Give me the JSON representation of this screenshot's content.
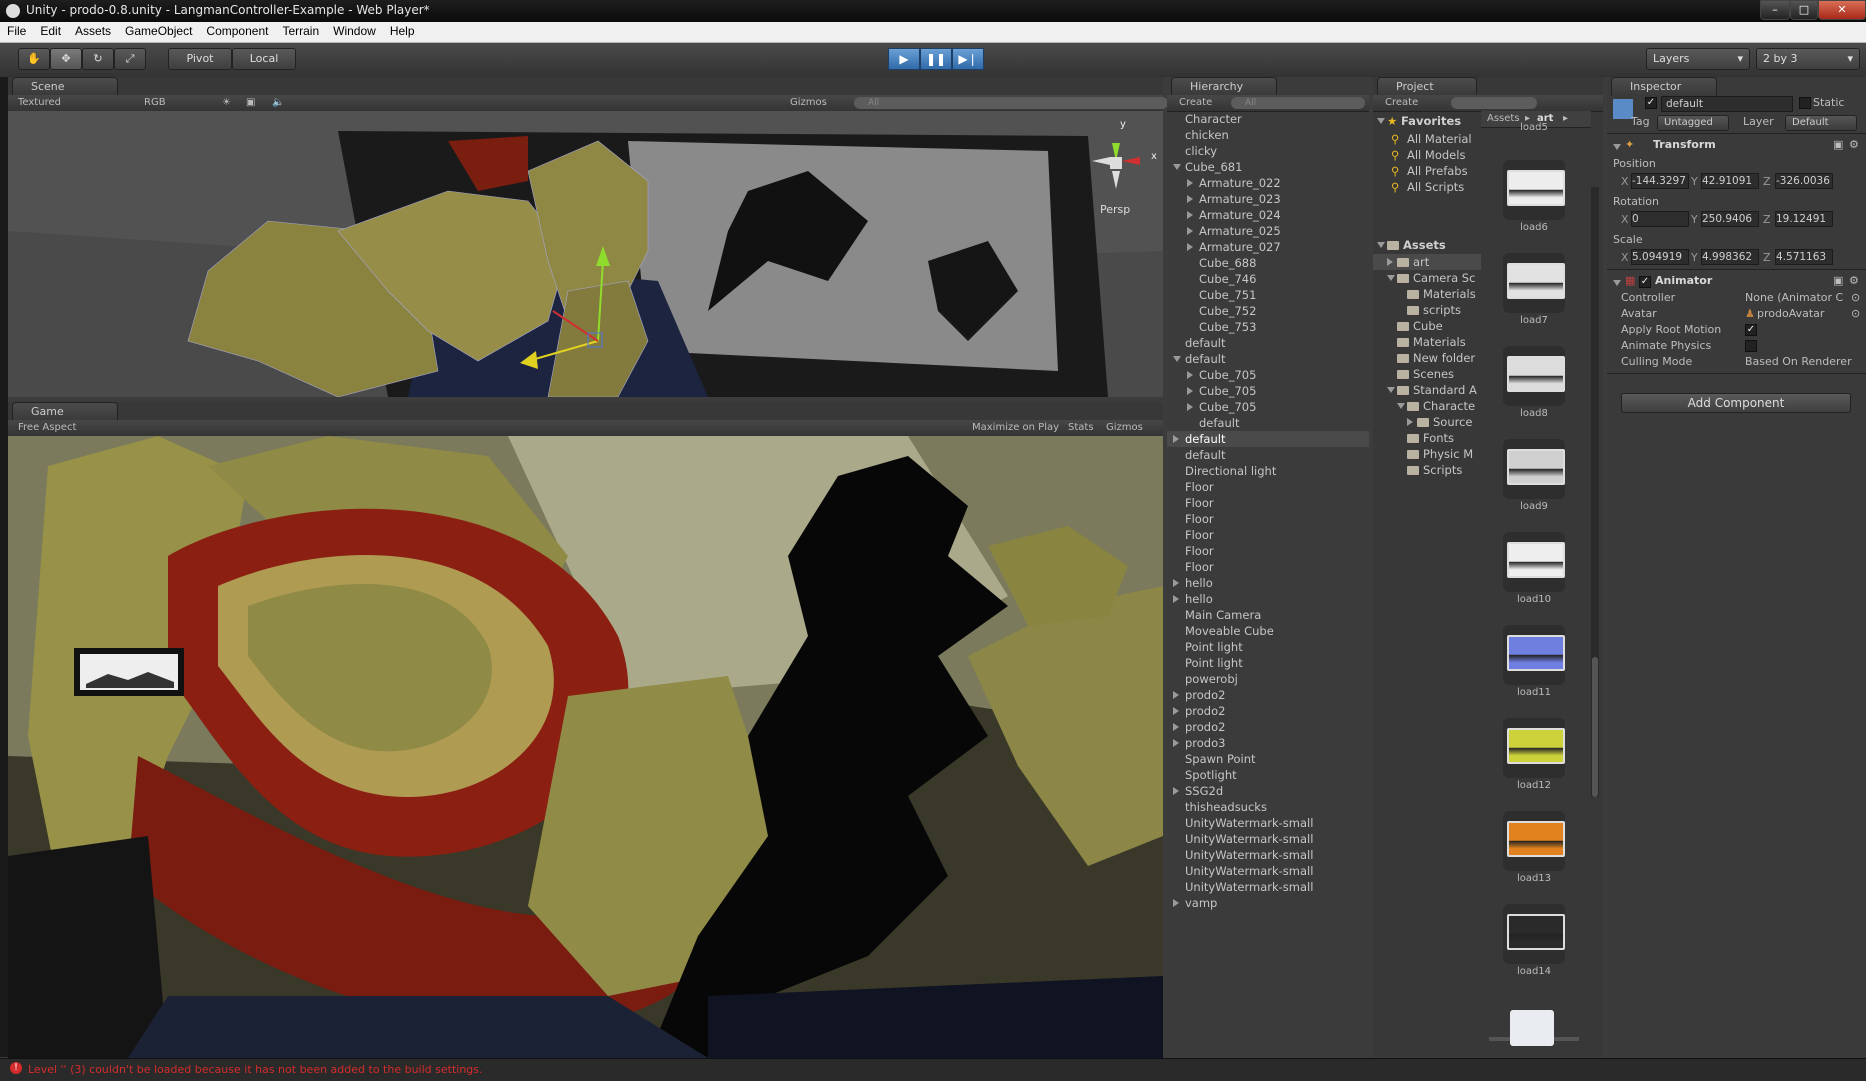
{
  "window": {
    "title": "Unity - prodo-0.8.unity - LangmanController-Example - Web Player*",
    "min": "–",
    "max": "□",
    "close": "✕"
  },
  "menu": [
    "File",
    "Edit",
    "Assets",
    "GameObject",
    "Component",
    "Terrain",
    "Window",
    "Help"
  ],
  "toolbar": {
    "pivot": "Pivot",
    "local": "Local",
    "layers": "Layers",
    "layout": "2 by 3"
  },
  "scene": {
    "tab": "Scene",
    "render_mode": "Textured",
    "color_mode": "RGB",
    "gizmos": "Gizmos",
    "search_placeholder": "All",
    "persp": "Persp",
    "axis_y": "y",
    "axis_x": "x"
  },
  "game": {
    "tab": "Game",
    "aspect": "Free Aspect",
    "maximize": "Maximize on Play",
    "stats": "Stats",
    "gizmos": "Gizmos"
  },
  "hierarchy": {
    "tab": "Hierarchy",
    "create": "Create",
    "search_placeholder": "All",
    "items": [
      {
        "label": "Character",
        "indent": 0,
        "arrow": "none"
      },
      {
        "label": "chicken",
        "indent": 0,
        "arrow": "none"
      },
      {
        "label": "clicky",
        "indent": 0,
        "arrow": "none"
      },
      {
        "label": "Cube_681",
        "indent": 0,
        "arrow": "down"
      },
      {
        "label": "Armature_022",
        "indent": 1,
        "arrow": "right"
      },
      {
        "label": "Armature_023",
        "indent": 1,
        "arrow": "right"
      },
      {
        "label": "Armature_024",
        "indent": 1,
        "arrow": "right"
      },
      {
        "label": "Armature_025",
        "indent": 1,
        "arrow": "right"
      },
      {
        "label": "Armature_027",
        "indent": 1,
        "arrow": "right"
      },
      {
        "label": "Cube_688",
        "indent": 1,
        "arrow": "none"
      },
      {
        "label": "Cube_746",
        "indent": 1,
        "arrow": "none"
      },
      {
        "label": "Cube_751",
        "indent": 1,
        "arrow": "none"
      },
      {
        "label": "Cube_752",
        "indent": 1,
        "arrow": "none"
      },
      {
        "label": "Cube_753",
        "indent": 1,
        "arrow": "none"
      },
      {
        "label": "default",
        "indent": 0,
        "arrow": "none"
      },
      {
        "label": "default",
        "indent": 0,
        "arrow": "down"
      },
      {
        "label": "Cube_705",
        "indent": 1,
        "arrow": "right"
      },
      {
        "label": "Cube_705",
        "indent": 1,
        "arrow": "right"
      },
      {
        "label": "Cube_705",
        "indent": 1,
        "arrow": "right"
      },
      {
        "label": "default",
        "indent": 1,
        "arrow": "none"
      },
      {
        "label": "default",
        "indent": 0,
        "arrow": "right",
        "selected": true
      },
      {
        "label": "default",
        "indent": 0,
        "arrow": "none"
      },
      {
        "label": "Directional light",
        "indent": 0,
        "arrow": "none"
      },
      {
        "label": "Floor",
        "indent": 0,
        "arrow": "none"
      },
      {
        "label": "Floor",
        "indent": 0,
        "arrow": "none"
      },
      {
        "label": "Floor",
        "indent": 0,
        "arrow": "none"
      },
      {
        "label": "Floor",
        "indent": 0,
        "arrow": "none"
      },
      {
        "label": "Floor",
        "indent": 0,
        "arrow": "none"
      },
      {
        "label": "Floor",
        "indent": 0,
        "arrow": "none"
      },
      {
        "label": "hello",
        "indent": 0,
        "arrow": "right"
      },
      {
        "label": "hello",
        "indent": 0,
        "arrow": "right"
      },
      {
        "label": "Main Camera",
        "indent": 0,
        "arrow": "none"
      },
      {
        "label": "Moveable Cube",
        "indent": 0,
        "arrow": "none"
      },
      {
        "label": "Point light",
        "indent": 0,
        "arrow": "none"
      },
      {
        "label": "Point light",
        "indent": 0,
        "arrow": "none"
      },
      {
        "label": "powerobj",
        "indent": 0,
        "arrow": "none"
      },
      {
        "label": "prodo2",
        "indent": 0,
        "arrow": "right"
      },
      {
        "label": "prodo2",
        "indent": 0,
        "arrow": "right"
      },
      {
        "label": "prodo2",
        "indent": 0,
        "arrow": "right"
      },
      {
        "label": "prodo3",
        "indent": 0,
        "arrow": "right"
      },
      {
        "label": "Spawn Point",
        "indent": 0,
        "arrow": "none"
      },
      {
        "label": "Spotlight",
        "indent": 0,
        "arrow": "none"
      },
      {
        "label": "SSG2d",
        "indent": 0,
        "arrow": "right"
      },
      {
        "label": "thisheadsucks",
        "indent": 0,
        "arrow": "none"
      },
      {
        "label": "UnityWatermark-small",
        "indent": 0,
        "arrow": "none"
      },
      {
        "label": "UnityWatermark-small",
        "indent": 0,
        "arrow": "none"
      },
      {
        "label": "UnityWatermark-small",
        "indent": 0,
        "arrow": "none"
      },
      {
        "label": "UnityWatermark-small",
        "indent": 0,
        "arrow": "none"
      },
      {
        "label": "UnityWatermark-small",
        "indent": 0,
        "arrow": "none"
      },
      {
        "label": "vamp",
        "indent": 0,
        "arrow": "right"
      }
    ]
  },
  "project": {
    "tab": "Project",
    "create": "Create",
    "favorites_label": "Favorites",
    "favorites": [
      "All Material",
      "All Models",
      "All Prefabs",
      "All Scripts"
    ],
    "assets_label": "Assets",
    "tree": [
      {
        "label": "art",
        "indent": 1,
        "arrow": "right",
        "selected": true
      },
      {
        "label": "Camera Sc",
        "indent": 1,
        "arrow": "down"
      },
      {
        "label": "Materials",
        "indent": 2,
        "arrow": "none"
      },
      {
        "label": "scripts",
        "indent": 2,
        "arrow": "none"
      },
      {
        "label": "Cube",
        "indent": 1,
        "arrow": "none"
      },
      {
        "label": "Materials",
        "indent": 1,
        "arrow": "none"
      },
      {
        "label": "New folder",
        "indent": 1,
        "arrow": "none"
      },
      {
        "label": "Scenes",
        "indent": 1,
        "arrow": "none"
      },
      {
        "label": "Standard A",
        "indent": 1,
        "arrow": "down"
      },
      {
        "label": "Characte",
        "indent": 2,
        "arrow": "down"
      },
      {
        "label": "Source",
        "indent": 3,
        "arrow": "right"
      },
      {
        "label": "Fonts",
        "indent": 2,
        "arrow": "none"
      },
      {
        "label": "Physic M",
        "indent": 2,
        "arrow": "none"
      },
      {
        "label": "Scripts",
        "indent": 2,
        "arrow": "none"
      }
    ],
    "breadcrumb": [
      "Assets",
      "art"
    ],
    "thumbs": [
      {
        "label": "load5",
        "color": "#bbbbbb"
      },
      {
        "label": "load6",
        "color": "#ededed"
      },
      {
        "label": "load7",
        "color": "#e2e2e2"
      },
      {
        "label": "load8",
        "color": "#dcdcdc"
      },
      {
        "label": "load9",
        "color": "#d0d0d0"
      },
      {
        "label": "load10",
        "color": "#eeeeee"
      },
      {
        "label": "load11",
        "color": "#6f7fe0"
      },
      {
        "label": "load12",
        "color": "#cdd23a"
      },
      {
        "label": "load13",
        "color": "#e1821f"
      },
      {
        "label": "load14",
        "color": "#2a2a2a"
      }
    ]
  },
  "inspector": {
    "tab": "Inspector",
    "object_name": "default",
    "static_label": "Static",
    "tag_label": "Tag",
    "tag_value": "Untagged",
    "layer_label": "Layer",
    "layer_value": "Default",
    "transform": {
      "title": "Transform",
      "position_label": "Position",
      "position": {
        "x": "-144.3297",
        "y": "42.91091",
        "z": "-326.0036"
      },
      "rotation_label": "Rotation",
      "rotation": {
        "x": "0",
        "y": "250.9406",
        "z": "19.12491"
      },
      "scale_label": "Scale",
      "scale": {
        "x": "5.094919",
        "y": "4.998362",
        "z": "4.571163"
      }
    },
    "axis_labels": {
      "x": "X",
      "y": "Y",
      "z": "Z"
    },
    "animator": {
      "title": "Animator",
      "controller_label": "Controller",
      "controller_value": "None (Animator C",
      "avatar_label": "Avatar",
      "avatar_value": "prodoAvatar",
      "root_motion_label": "Apply Root Motion",
      "physics_label": "Animate Physics",
      "culling_label": "Culling Mode",
      "culling_value": "Based On Renderer"
    },
    "add_component": "Add Component"
  },
  "status": {
    "message": "Level '' (3) couldn't be loaded because it has not been added to the build settings.",
    "color": "#d42c2c"
  },
  "colors": {
    "accent": "#3a72b0",
    "selected_row": "#4a4a4a",
    "olive": "#8a8340"
  }
}
